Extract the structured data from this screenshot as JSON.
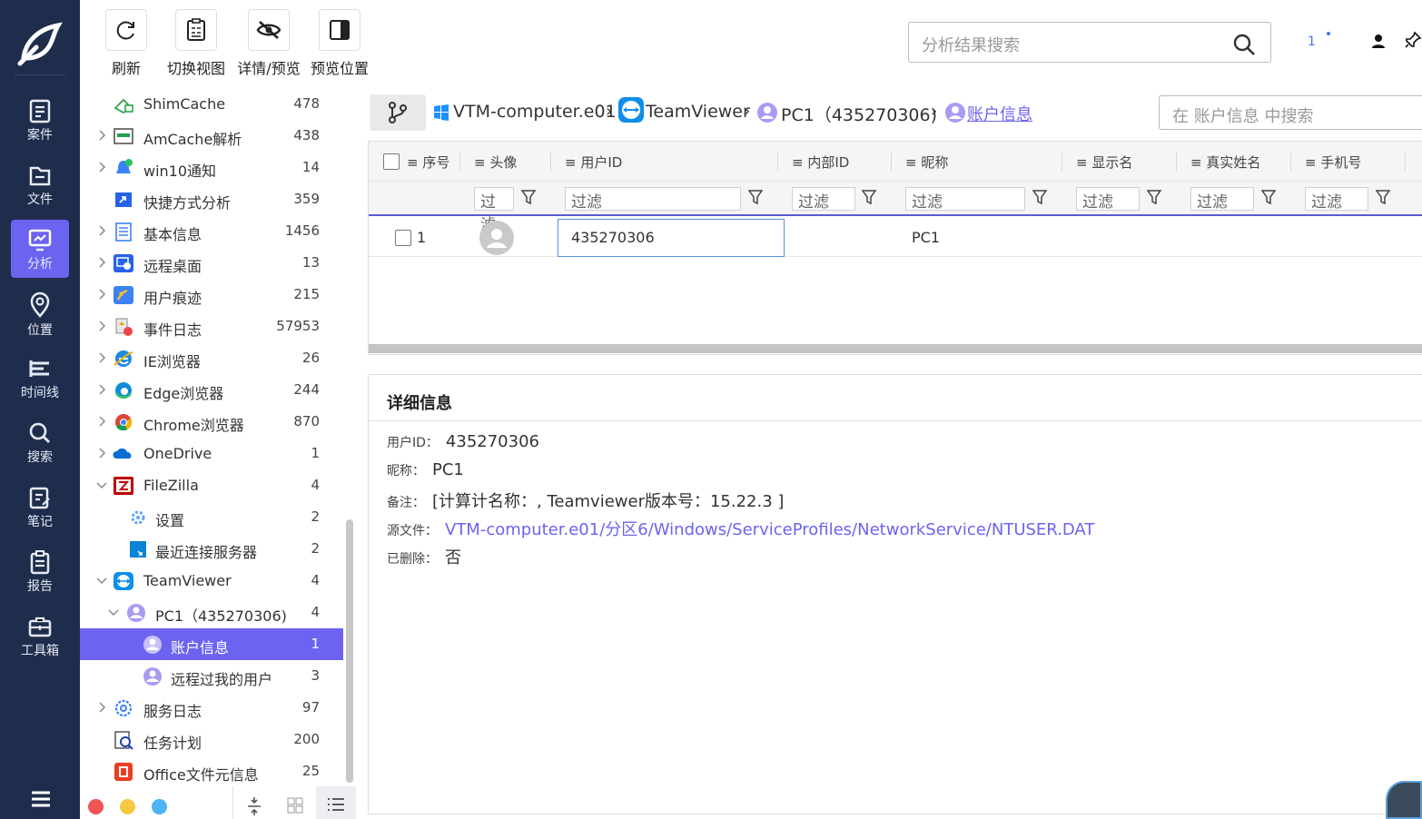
{
  "rail": {
    "items": [
      {
        "label": "案件",
        "icon": "case-icon"
      },
      {
        "label": "文件",
        "icon": "folder-icon"
      },
      {
        "label": "分析",
        "icon": "analysis-icon"
      },
      {
        "label": "位置",
        "icon": "location-icon"
      },
      {
        "label": "时间线",
        "icon": "timeline-icon"
      },
      {
        "label": "搜索",
        "icon": "search-icon"
      },
      {
        "label": "笔记",
        "icon": "note-icon"
      },
      {
        "label": "报告",
        "icon": "report-icon"
      },
      {
        "label": "工具箱",
        "icon": "toolbox-icon"
      }
    ],
    "active_index": 2
  },
  "toolbar": {
    "refresh": "刷新",
    "switch_view": "切换视图",
    "detail_preview": "详情/预览",
    "preview_position": "预览位置",
    "search_placeholder": "分析结果搜索",
    "notify_count": "1"
  },
  "tree": {
    "items": [
      {
        "label": "ShimCache",
        "count": "478"
      },
      {
        "label": "AmCache解析",
        "count": "438"
      },
      {
        "label": "win10通知",
        "count": "14"
      },
      {
        "label": "快捷方式分析",
        "count": "359"
      },
      {
        "label": "基本信息",
        "count": "1456"
      },
      {
        "label": "远程桌面",
        "count": "13"
      },
      {
        "label": "用户痕迹",
        "count": "215"
      },
      {
        "label": "事件日志",
        "count": "57953"
      },
      {
        "label": "IE浏览器",
        "count": "26"
      },
      {
        "label": "Edge浏览器",
        "count": "244"
      },
      {
        "label": "Chrome浏览器",
        "count": "870"
      },
      {
        "label": "OneDrive",
        "count": "1"
      },
      {
        "label": "FileZilla",
        "count": "4"
      },
      {
        "label": "设置",
        "count": "2"
      },
      {
        "label": "最近连接服务器",
        "count": "2"
      },
      {
        "label": "TeamViewer",
        "count": "4"
      },
      {
        "label": "PC1（435270306)",
        "count": "4"
      },
      {
        "label": "账户信息",
        "count": "1"
      },
      {
        "label": "远程过我的用户",
        "count": "3"
      },
      {
        "label": "服务日志",
        "count": "97"
      },
      {
        "label": "任务计划",
        "count": "200"
      },
      {
        "label": "Office文件元信息",
        "count": "25"
      }
    ]
  },
  "breadcrumb": {
    "items": [
      "VTM-computer.e01",
      "TeamViewer",
      "PC1（435270306)",
      "账户信息"
    ],
    "search_placeholder": "在 账户信息 中搜索"
  },
  "grid": {
    "columns": [
      "序号",
      "头像",
      "用户ID",
      "内部ID",
      "昵称",
      "显示名",
      "真实姓名",
      "手机号"
    ],
    "filter_placeholder": "过滤",
    "rows": [
      {
        "index": "1",
        "user_id": "435270306",
        "internal_id": "",
        "nickname": "PC1"
      }
    ]
  },
  "detail": {
    "title": "详细信息",
    "fields": [
      {
        "key": "用户ID：",
        "value": "435270306"
      },
      {
        "key": "昵称：",
        "value": "PC1"
      },
      {
        "key": "备注：",
        "value": "[计算计名称：, Teamviewer版本号：15.22.3 ]"
      },
      {
        "key": "源文件：",
        "value": "VTM-computer.e01/分区6/Windows/ServiceProfiles/NetworkService/NTUSER.DAT"
      },
      {
        "key": "已删除：",
        "value": "否"
      }
    ]
  },
  "colors": {
    "accent": "#6c63f0",
    "rail_bg": "#1f2d4c",
    "link": "#6c63f0"
  }
}
